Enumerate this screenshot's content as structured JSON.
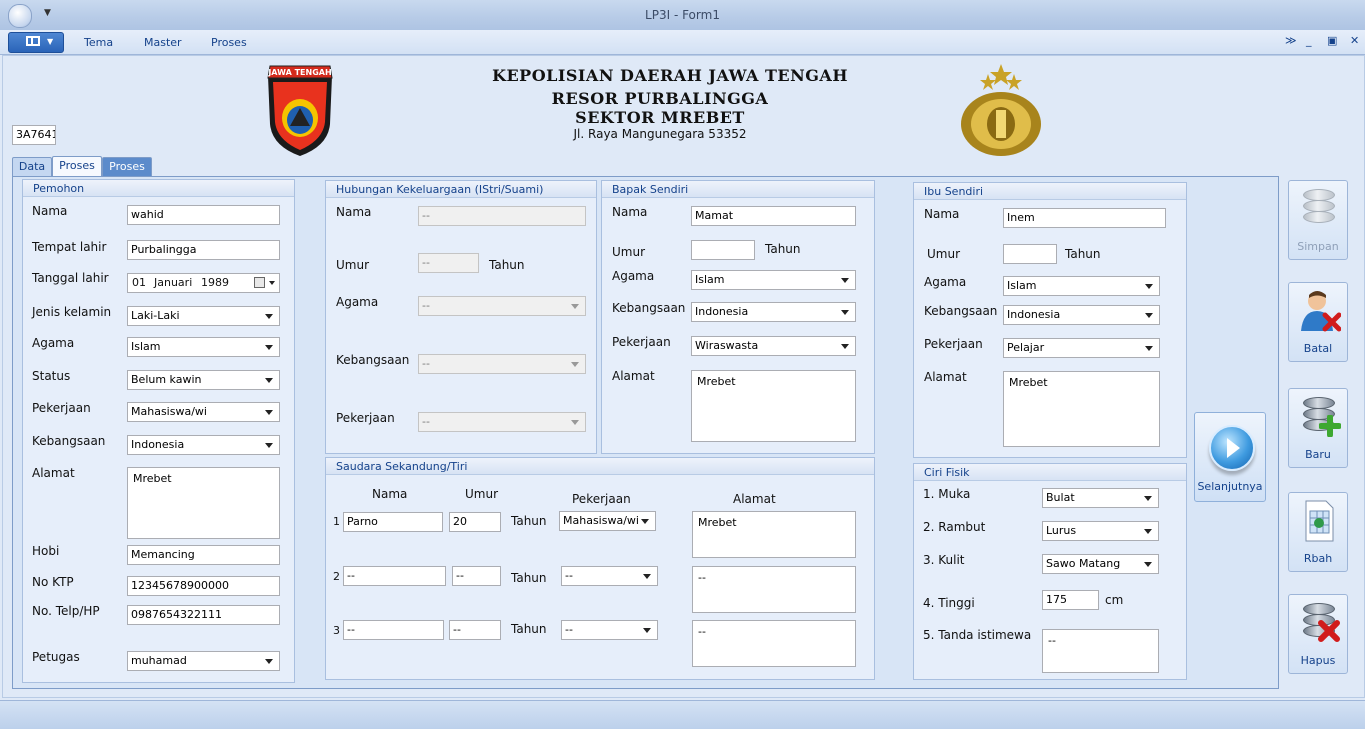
{
  "window": {
    "title": "LP3I - Form1"
  },
  "ribbon": {
    "tabs": [
      "Tema",
      "Master",
      "Proses"
    ]
  },
  "header": {
    "line1": "KEPOLISIAN DAERAH JAWA TENGAH",
    "line2": "RESOR PURBALINGGA",
    "line3": "SEKTOR MREBET",
    "address": "Jl. Raya Mangunegara 53352",
    "logo_left_text": "JAWA TENGAH",
    "record_id": "3A7641("
  },
  "tabs": [
    "Data",
    "Proses",
    "Proses"
  ],
  "pemohon": {
    "title": "Pemohon",
    "labels": {
      "nama": "Nama",
      "tempat": "Tempat lahir",
      "tanggal": "Tanggal lahir",
      "jk": "Jenis kelamin",
      "agama": "Agama",
      "status": "Status",
      "pekerjaan": "Pekerjaan",
      "kebangsaan": "Kebangsaan",
      "alamat": "Alamat",
      "hobi": "Hobi",
      "ktp": "No KTP",
      "telp": "No. Telp/HP",
      "petugas": "Petugas"
    },
    "values": {
      "nama": "wahid",
      "tempat": "Purbalingga",
      "tgl_day": "01",
      "tgl_month": "Januari",
      "tgl_year": "1989",
      "jk": "Laki-Laki",
      "agama": "Islam",
      "status": "Belum kawin",
      "pekerjaan": "Mahasiswa/wi",
      "kebangsaan": "Indonesia",
      "alamat": "Mrebet",
      "hobi": "Memancing",
      "ktp": "12345678900000",
      "telp": "0987654322111",
      "petugas": "muhamad"
    }
  },
  "pasangan": {
    "title": "Hubungan Kekeluargaan (IStri/Suami)",
    "labels": {
      "nama": "Nama",
      "umur": "Umur",
      "tahun": "Tahun",
      "agama": "Agama",
      "kebangsaan": "Kebangsaan",
      "pekerjaan": "Pekerjaan"
    },
    "values": {
      "nama": "--",
      "umur": "--",
      "agama": "--",
      "kebangsaan": "--",
      "pekerjaan": "--"
    }
  },
  "bapak": {
    "title": "Bapak Sendiri",
    "labels": {
      "nama": "Nama",
      "umur": "Umur",
      "tahun": "Tahun",
      "agama": "Agama",
      "kebangsaan": "Kebangsaan",
      "pekerjaan": "Pekerjaan",
      "alamat": "Alamat"
    },
    "values": {
      "nama": "Mamat",
      "umur": "",
      "agama": "Islam",
      "kebangsaan": "Indonesia",
      "pekerjaan": "Wiraswasta",
      "alamat": "Mrebet"
    }
  },
  "ibu": {
    "title": "Ibu Sendiri",
    "labels": {
      "nama": "Nama",
      "umur": "Umur",
      "tahun": "Tahun",
      "agama": "Agama",
      "kebangsaan": "Kebangsaan",
      "pekerjaan": "Pekerjaan",
      "alamat": "Alamat"
    },
    "values": {
      "nama": "Inem",
      "umur": "",
      "agama": "Islam",
      "kebangsaan": "Indonesia",
      "pekerjaan": "Pelajar",
      "alamat": "Mrebet"
    }
  },
  "saudara": {
    "title": "Saudara Sekandung/Tiri",
    "headers": {
      "nama": "Nama",
      "umur": "Umur",
      "pekerjaan": "Pekerjaan",
      "alamat": "Alamat"
    },
    "tahun": "Tahun",
    "rows": [
      {
        "no": "1",
        "nama": "Parno",
        "umur": "20",
        "pekerjaan": "Mahasiswa/wi",
        "alamat": "Mrebet"
      },
      {
        "no": "2",
        "nama": "--",
        "umur": "--",
        "pekerjaan": "--",
        "alamat": "--"
      },
      {
        "no": "3",
        "nama": "--",
        "umur": "--",
        "pekerjaan": "--",
        "alamat": "--"
      }
    ]
  },
  "ciri": {
    "title": "Ciri Fisik",
    "labels": {
      "muka": "1. Muka",
      "rambut": "2. Rambut",
      "kulit": "3. Kulit",
      "tinggi": "4. Tinggi",
      "tanda": "5. Tanda istimewa",
      "cm": "cm"
    },
    "values": {
      "muka": "Bulat",
      "rambut": "Lurus",
      "kulit": "Sawo Matang",
      "tinggi": "175",
      "tanda": "--"
    }
  },
  "buttons": {
    "next": "Selanjutnya",
    "simpan": "Simpan",
    "batal": "Batal",
    "baru": "Baru",
    "rbah": "Rbah",
    "hapus": "Hapus"
  }
}
